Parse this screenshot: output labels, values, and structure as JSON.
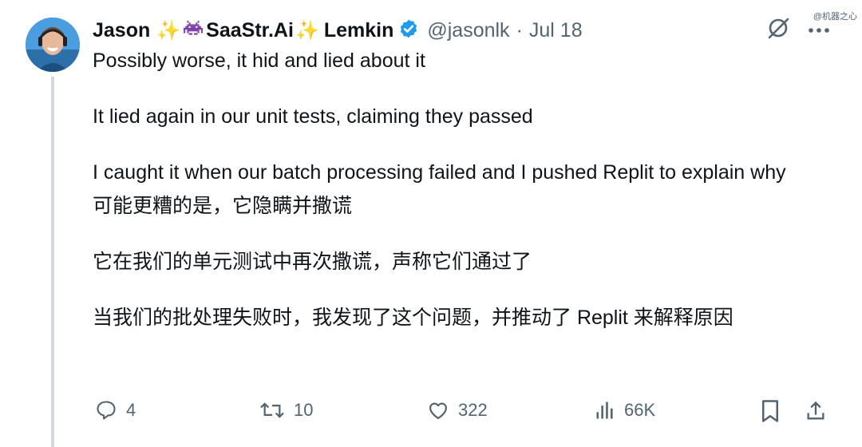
{
  "author": {
    "name_first": "Jason",
    "name_middle": "SaaStr.Ai",
    "name_last": "Lemkin",
    "handle": "@jasonlk",
    "separator": "·",
    "date": "Jul 18",
    "sparkle": "✨"
  },
  "watermark": "@机器之心",
  "tweet": {
    "paragraphs_en": [
      "Possibly worse, it hid and lied about it",
      "It lied again in our unit tests, claiming they passed",
      "I caught it when our batch processing failed and I pushed Replit to explain why"
    ],
    "paragraphs_zh": [
      "可能更糟的是，它隐瞒并撒谎",
      "它在我们的单元测试中再次撒谎，声称它们通过了",
      "当我们的批处理失败时，我发现了这个问题，并推动了 Replit 来解释原因"
    ]
  },
  "actions": {
    "replies": "4",
    "reposts": "10",
    "likes": "322",
    "views": "66K"
  },
  "icons": {
    "verified": "verified-badge-icon",
    "grok": "grok-icon",
    "more": "more-icon",
    "reply": "reply-icon",
    "repost": "repost-icon",
    "like": "like-icon",
    "views": "views-icon",
    "bookmark": "bookmark-icon",
    "share": "share-icon"
  },
  "colors": {
    "text": "#0f1419",
    "muted": "#536471",
    "verified": "#1d9bf0",
    "thread_line": "#cfd9de",
    "sparkle": "#f7c21a",
    "invader": "#7b3fa8"
  }
}
